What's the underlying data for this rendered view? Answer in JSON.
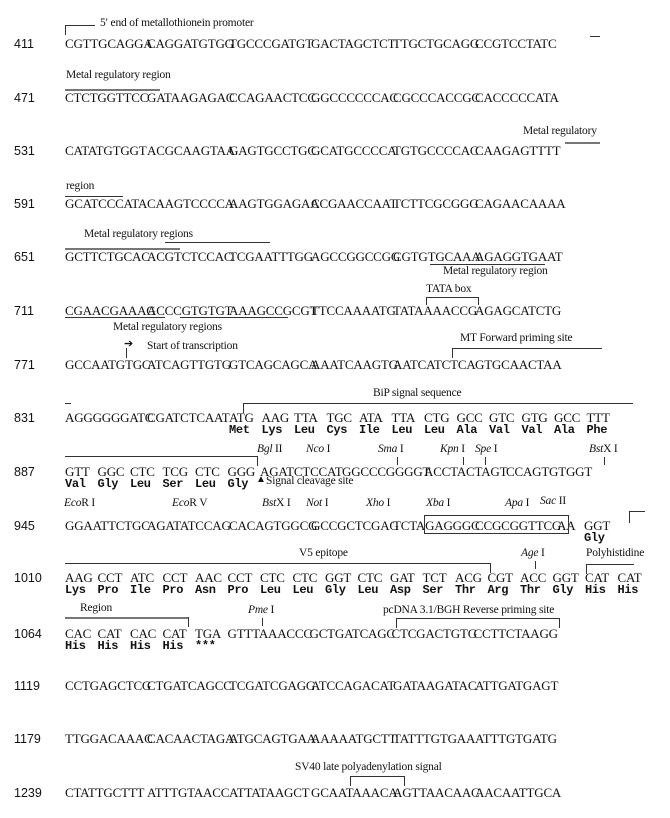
{
  "rows": [
    {
      "num": "411",
      "parts": [
        "CGTTGCAGGA",
        "CAGGATGTGG",
        "TGCCCGATGT",
        "GACTAGCTCT",
        "TTGCTGCAGG",
        "CCGTCCTATC"
      ]
    },
    {
      "num": "471",
      "parts": [
        "CTCTGGTTCC",
        "GATAAGAGAC",
        "CCAGAACTCC",
        "GGCCCCCCAC",
        "CGCCCACCGC",
        "CACCCCCATA"
      ]
    },
    {
      "num": "531",
      "parts": [
        "CATATGTGGT",
        "ACGCAAGTAA",
        "GAGTGCCTGC",
        "GCATGCCCCA",
        "TGTGCCCCAC",
        "CAAGAGTTTT"
      ]
    },
    {
      "num": "591",
      "parts": [
        "GCATCCCATA",
        "CAAGTCCCCA",
        "AAGTGGAGAA",
        "CCGAACCAAT",
        "TCTTCGCGGG",
        "CAGAACAAAA"
      ]
    },
    {
      "num": "651",
      "parts": [
        "GCTTCTGCAC",
        "ACGTCTCCAC",
        "TCGAATTTGG",
        "AGCCGGCCGG",
        "CGTGTGCAAA",
        "AGAGGTGAAT"
      ]
    },
    {
      "num": "711",
      "parts": [
        "CGAACGAAAG",
        "ACCCGTGTGT",
        "AAAGCCGCGT",
        "TTCCAAAATG",
        "TATAAAACCG",
        "AGAGCATCTG"
      ]
    },
    {
      "num": "771",
      "parts": [
        "GCCAATGTGC",
        "ATCAGTTGTG",
        "GTCAGCAGCA",
        "AAATCAAGTG",
        "AATCATCTCA",
        "GTGCAACTAA"
      ]
    },
    {
      "num": "831",
      "parts": [
        "AGGGGGGATC",
        "CGATCTCAAT",
        "ATG",
        "AAG",
        "TTA",
        "TGC",
        "ATA",
        "TTA",
        "CTG",
        "GCC",
        "GTC",
        "GTG",
        "GCC",
        "TTT"
      ],
      "aa": [
        "",
        "",
        "Met",
        "Lys",
        "Leu",
        "Cys",
        "Ile",
        "Leu",
        "Leu",
        "Ala",
        "Val",
        "Val",
        "Ala",
        "Phe"
      ]
    },
    {
      "num": "887",
      "parts": [
        "GTT",
        "GGC",
        "CTC",
        "TCG",
        "CTC",
        "GGG",
        "AGATCTCCAT",
        "GGCCCGGGGT",
        "ACCTACTAGT",
        "CCAGTGTGGT"
      ],
      "aa": [
        "Val",
        "Gly",
        "Leu",
        "Ser",
        "Leu",
        "Gly",
        "",
        "",
        "",
        ""
      ]
    },
    {
      "num": "945",
      "parts": [
        "GGAATTCTGC",
        "AGATATCCAG",
        "CACAGTGGCG",
        "GCCGCTCGAG",
        "TCTAGAGGGC",
        "CCGCGGTTCG",
        "AA",
        "GGT"
      ],
      "aa": [
        "",
        "",
        "",
        "",
        "",
        "",
        "",
        "Gly"
      ]
    },
    {
      "num": "1010",
      "parts": [
        "AAG",
        "CCT",
        "ATC",
        "CCT",
        "AAC",
        "CCT",
        "CTC",
        "CTC",
        "GGT",
        "CTC",
        "GAT",
        "TCT",
        "ACG",
        "CGT",
        "ACC",
        "GGT",
        "CAT",
        "CAT"
      ],
      "aa": [
        "Lys",
        "Pro",
        "Ile",
        "Pro",
        "Asn",
        "Pro",
        "Leu",
        "Leu",
        "Gly",
        "Leu",
        "Asp",
        "Ser",
        "Thr",
        "Arg",
        "Thr",
        "Gly",
        "His",
        "His"
      ]
    },
    {
      "num": "1064",
      "parts": [
        "CAC",
        "CAT",
        "CAC",
        "CAT",
        "TGA",
        "GTTTAAACCC",
        "GCTGATCAGC",
        "CTCGACTGTG",
        "CCTTCTAAGG"
      ],
      "aa": [
        "His",
        "His",
        "His",
        "His",
        "***",
        "",
        "",
        "",
        ""
      ]
    },
    {
      "num": "1119",
      "parts": [
        "CCTGAGCTCG",
        "CTGATCAGCC",
        "TCGATCGAGG",
        "ATCCAGACAT",
        "GATAAGATAC",
        "ATTGATGAGT"
      ]
    },
    {
      "num": "1179",
      "parts": [
        "TTGGACAAAC",
        "CACAACTAGA",
        "ATGCAGTGAA",
        "AAAAATGCTT",
        "TATTTGTGAA",
        "ATTTGTGATG"
      ]
    },
    {
      "num": "1239",
      "parts": [
        "CTATTGCTTT",
        "ATTTGTAACC",
        "ATTATAAGCT",
        "GCAATAAACA",
        "AGTTAACAAC",
        "AACAATTGCA"
      ]
    }
  ],
  "annotations": {
    "mt_promoter_5end": "5′ end of metallothionein promoter",
    "metal_reg_1": "Metal regulatory region",
    "metal_reg_2a": "Metal regulatory",
    "metal_reg_2b": "region",
    "metal_reg_3": "Metal regulatory regions",
    "metal_reg_4": "Metal regulatory region",
    "tata_box": "TATA box",
    "metal_reg_5": "Metal regulatory regions",
    "start_transcription": "Start of transcription",
    "mt_forward": "MT Forward priming site",
    "bip_signal": "BiP signal sequence",
    "signal_cleavage": "Signal cleavage site",
    "v5_epitope": "V5 epitope",
    "polyhis_a": "Polyhistidine",
    "polyhis_b": "Region",
    "bgh_reverse": "pcDNA 3.1/BGH Reverse priming site",
    "sv40_polya": "SV40 late polyadenylation signal"
  },
  "sites": {
    "bgl2": {
      "italic": "Bgl",
      "rest": " II"
    },
    "nco1": {
      "italic": "Nco",
      "rest": " I"
    },
    "sma1": {
      "italic": "Sma",
      "rest": " I"
    },
    "kpn1": {
      "italic": "Kpn",
      "rest": " I"
    },
    "spe1": {
      "italic": "Spe",
      "rest": " I"
    },
    "bstx1a": {
      "italic": "Bst",
      "rest": "X I"
    },
    "ecor1": {
      "italic": "Eco",
      "rest": "R I"
    },
    "ecor5": {
      "italic": "Eco",
      "rest": "R V"
    },
    "bstx1b": {
      "italic": "Bst",
      "rest": "X I"
    },
    "not1": {
      "italic": "Not",
      "rest": " I"
    },
    "xho1": {
      "italic": "Xho",
      "rest": " I"
    },
    "xba1": {
      "italic": "Xba",
      "rest": " I"
    },
    "apa1": {
      "italic": "Apa",
      "rest": " I"
    },
    "sac2": {
      "italic": "Sac",
      "rest": " II"
    },
    "age1": {
      "italic": "Age",
      "rest": " I"
    },
    "pme1": {
      "italic": "Pme",
      "rest": " I"
    }
  },
  "icons": {
    "cleavage_marker": "triangle-up",
    "transcription_start": "arrow-right"
  }
}
